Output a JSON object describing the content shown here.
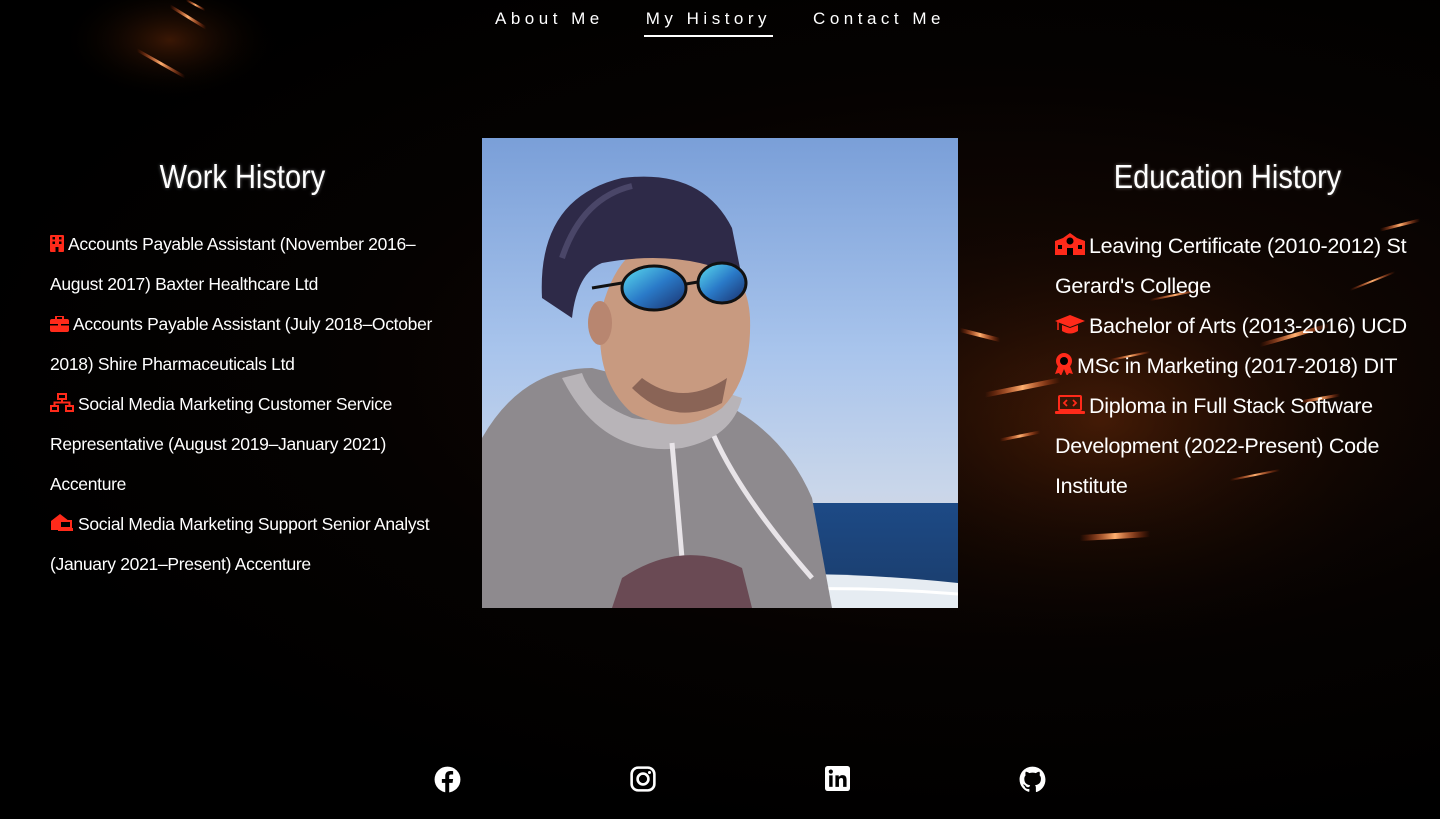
{
  "nav": {
    "items": [
      {
        "label": "About Me",
        "active": false
      },
      {
        "label": "My History",
        "active": true
      },
      {
        "label": "Contact Me",
        "active": false
      }
    ]
  },
  "work": {
    "title": "Work History",
    "items": [
      {
        "icon": "building-icon",
        "text": "Accounts Payable Assistant (November 2016–August 2017) Baxter Healthcare Ltd"
      },
      {
        "icon": "briefcase-icon",
        "text": "Accounts Payable Assistant (July 2018–October 2018) Shire Pharmaceuticals Ltd"
      },
      {
        "icon": "network-icon",
        "text": "Social Media Marketing Customer Service Representative (August 2019–January 2021) Accenture"
      },
      {
        "icon": "house-laptop-icon",
        "text": "Social Media Marketing Support Senior Analyst (January 2021–Present) Accenture"
      }
    ]
  },
  "education": {
    "title": "Education History",
    "items": [
      {
        "icon": "school-icon",
        "text": "Leaving Certificate (2010-2012) St Gerard's College"
      },
      {
        "icon": "graduation-cap-icon",
        "text": "Bachelor of Arts (2013-2016) UCD"
      },
      {
        "icon": "award-icon",
        "text": "MSc in Marketing (2017-2018) DIT"
      },
      {
        "icon": "laptop-code-icon",
        "text": "Diploma in Full Stack Software Development (2022-Present) Code Institute"
      }
    ]
  },
  "photo": {
    "alt": "Portrait photo of man in cap and sunglasses by the sea"
  },
  "social": [
    {
      "icon": "facebook-icon"
    },
    {
      "icon": "instagram-icon"
    },
    {
      "icon": "linkedin-icon"
    },
    {
      "icon": "github-icon"
    }
  ],
  "colors": {
    "accent": "#ff2a1a",
    "background": "#000000",
    "text": "#ffffff"
  }
}
